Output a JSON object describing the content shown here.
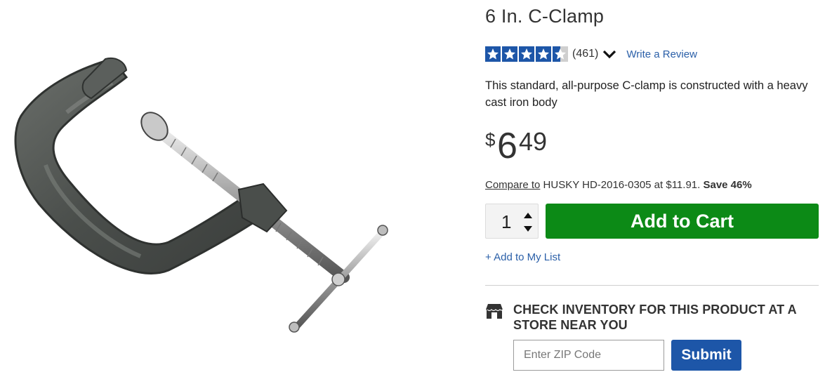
{
  "product": {
    "title": "6 In. C-Clamp",
    "image_alt": "C-clamp",
    "rating": {
      "stars": 4.5,
      "count_text": "(461)",
      "write_review": "Write a Review"
    },
    "description": "This standard, all-purpose C-clamp is constructed with a heavy cast iron body",
    "price": {
      "currency": "$",
      "dollars": "6",
      "cents": "49"
    },
    "compare": {
      "link": "Compare to",
      "text": " HUSKY HD-2016-0305 at $11.91. ",
      "save": "Save 46%"
    }
  },
  "cart": {
    "quantity": "1",
    "add_label": "Add to Cart",
    "add_to_list": "+ Add to My List"
  },
  "inventory": {
    "heading": "CHECK INVENTORY FOR THIS PRODUCT AT A STORE NEAR YOU",
    "zip_placeholder": "Enter ZIP Code",
    "submit_label": "Submit"
  },
  "colors": {
    "add_to_cart": "#0c8a16",
    "submit": "#1d56a8",
    "star": "#1d56a8",
    "link": "#2a5fa8"
  }
}
